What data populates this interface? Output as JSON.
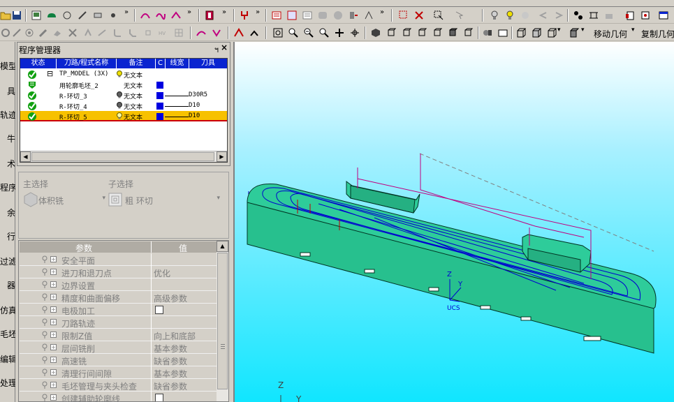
{
  "toolbar": {
    "move_geometry": "移动几何",
    "copy_geometry": "复制几何"
  },
  "left_strip": [
    "模型",
    "具",
    "轨迹",
    "牛",
    "术",
    "程序",
    "余",
    "行",
    "过滤",
    "器",
    "仿真",
    "毛坯",
    "编辑",
    "处理"
  ],
  "program_manager": {
    "title": "程序管理器",
    "pin": "ฯ",
    "close": "×",
    "columns": [
      "状态",
      "刀路/程式名称",
      "备注",
      "C",
      "线宽",
      "刀具"
    ],
    "rows": [
      {
        "name": "TP_MODEL (3X)",
        "note": "无文本",
        "tool": "",
        "selected": false,
        "expander": "⊟"
      },
      {
        "name": "用轮廓毛坯_2",
        "note": "无文本",
        "tool": "",
        "selected": false
      },
      {
        "name": "R-环切_3",
        "note": "无文本",
        "tool": "D30R5",
        "selected": false
      },
      {
        "name": "R-环切_4",
        "note": "无文本",
        "tool": "D10",
        "selected": false
      },
      {
        "name": "R-环切_5",
        "note": "无文本",
        "tool": "D10",
        "selected": true
      }
    ]
  },
  "selection": {
    "main_label": "主选择",
    "main_value": "体积铣",
    "sub_label": "子选择",
    "sub_value": "粗 环切"
  },
  "params": {
    "col_param": "参数",
    "col_value": "值",
    "rows": [
      {
        "name": "安全平面",
        "value": ""
      },
      {
        "name": "进刀和退刀点",
        "value": "优化"
      },
      {
        "name": "边界设置",
        "value": ""
      },
      {
        "name": "精度和曲面偏移",
        "value": "高级参数"
      },
      {
        "name": "电极加工",
        "value": "",
        "checkbox": true
      },
      {
        "name": "刀路轨迹",
        "value": ""
      },
      {
        "name": "限制Z值",
        "value": "向上和底部"
      },
      {
        "name": "层间铣削",
        "value": "基本参数"
      },
      {
        "name": "高速铣",
        "value": "缺省参数"
      },
      {
        "name": "清理行间间隙",
        "value": "基本参数"
      },
      {
        "name": "毛坯管理与夹头检查",
        "value": "缺省参数"
      },
      {
        "name": "创建辅助轮廓线",
        "value": "",
        "checkbox": true
      }
    ]
  },
  "viewport": {
    "ucs_label": "UCS",
    "axis_z": "Z",
    "axis_y": "Y",
    "world_z": "Z",
    "world_y": "Y"
  },
  "colors": {
    "title_blue": "#0a24d0",
    "selected_row": "#f7c100",
    "part_green": "#2fc79a",
    "toolpath_blue": "#0000d0",
    "viewport_cyan": "#10e6ff"
  }
}
